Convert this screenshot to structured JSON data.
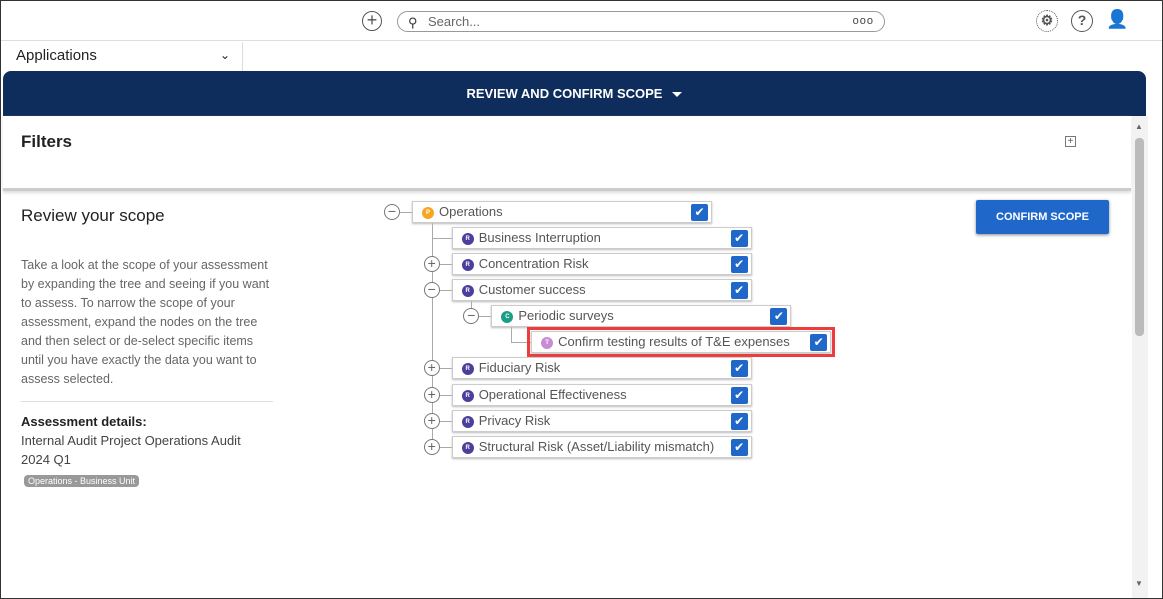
{
  "topbar": {
    "search_placeholder": "Search...",
    "more": "ooo",
    "icons": [
      "add-icon",
      "search-icon",
      "settings-icon",
      "help-icon",
      "user-icon"
    ]
  },
  "apps": {
    "label": "Applications"
  },
  "banner": {
    "title": "REVIEW AND CONFIRM SCOPE"
  },
  "filters": {
    "title": "Filters"
  },
  "scope": {
    "title": "Review your scope",
    "description": "Take a look at the scope of your assessment by expanding the tree and seeing if you want to assess. To narrow the scope of your assessment, expand the nodes on the tree and then select or de-select specific items until you have exactly the data you want to assess selected.",
    "details_label": "Assessment details:",
    "details_value": "Internal Audit Project Operations Audit 2024 Q1",
    "badge": "Operations - Business Unit"
  },
  "confirm_label": "CONFIRM SCOPE",
  "tree": [
    {
      "label": "Operations",
      "level": 0,
      "toggle": "minus",
      "type": "P",
      "color": "#f5a623",
      "checked": true
    },
    {
      "label": "Business Interruption",
      "level": 1,
      "toggle": "none",
      "type": "R",
      "color": "#4b3f9e",
      "checked": true
    },
    {
      "label": "Concentration Risk",
      "level": 1,
      "toggle": "plus",
      "type": "R",
      "color": "#4b3f9e",
      "checked": true
    },
    {
      "label": "Customer success",
      "level": 1,
      "toggle": "minus",
      "type": "R",
      "color": "#4b3f9e",
      "checked": true
    },
    {
      "label": "Periodic surveys",
      "level": 2,
      "toggle": "minus",
      "type": "C",
      "color": "#1a9e86",
      "checked": true
    },
    {
      "label": "Confirm testing results of T&E expenses",
      "level": 3,
      "toggle": "none",
      "type": "T",
      "color": "#c98bd6",
      "checked": true,
      "highlighted": true
    },
    {
      "label": "Fiduciary Risk",
      "level": 1,
      "toggle": "plus",
      "type": "R",
      "color": "#4b3f9e",
      "checked": true
    },
    {
      "label": "Operational Effectiveness",
      "level": 1,
      "toggle": "plus",
      "type": "R",
      "color": "#4b3f9e",
      "checked": true
    },
    {
      "label": "Privacy Risk",
      "level": 1,
      "toggle": "plus",
      "type": "R",
      "color": "#4b3f9e",
      "checked": true
    },
    {
      "label": "Structural Risk (Asset/Liability mismatch)",
      "level": 1,
      "toggle": "plus",
      "type": "R",
      "color": "#4b3f9e",
      "checked": true
    }
  ]
}
